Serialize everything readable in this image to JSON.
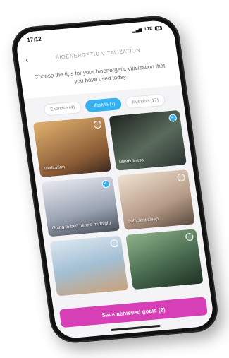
{
  "status": {
    "time": "17:12",
    "network": "LTE"
  },
  "header": {
    "title": "BIOENERGETIC VITALIZATION"
  },
  "intro": {
    "text": "Choose the tips for your bioenergetic vitalization that you have used today."
  },
  "tabs": [
    {
      "label": "Exercise (4)",
      "active": false
    },
    {
      "label": "Lifestyle (7)",
      "active": true
    },
    {
      "label": "Nutrition (17)",
      "active": false
    }
  ],
  "cards": [
    {
      "label": "Meditation",
      "checked": false,
      "color": "#c48a4a"
    },
    {
      "label": "Mindfulness",
      "checked": true,
      "color": "#4f5a4f"
    },
    {
      "label": "Going to bed before midnight",
      "checked": true,
      "color": "#9aa3b3"
    },
    {
      "label": "Sufficient sleep",
      "checked": false,
      "color": "#b59a86"
    },
    {
      "label": "",
      "checked": false,
      "color": "#a3bfd4"
    },
    {
      "label": "",
      "checked": false,
      "color": "#496b4f"
    }
  ],
  "save_button": {
    "label": "Save achieved goals (2)"
  },
  "colors": {
    "accent": "#35b1f2",
    "save": "#d63fb6"
  }
}
